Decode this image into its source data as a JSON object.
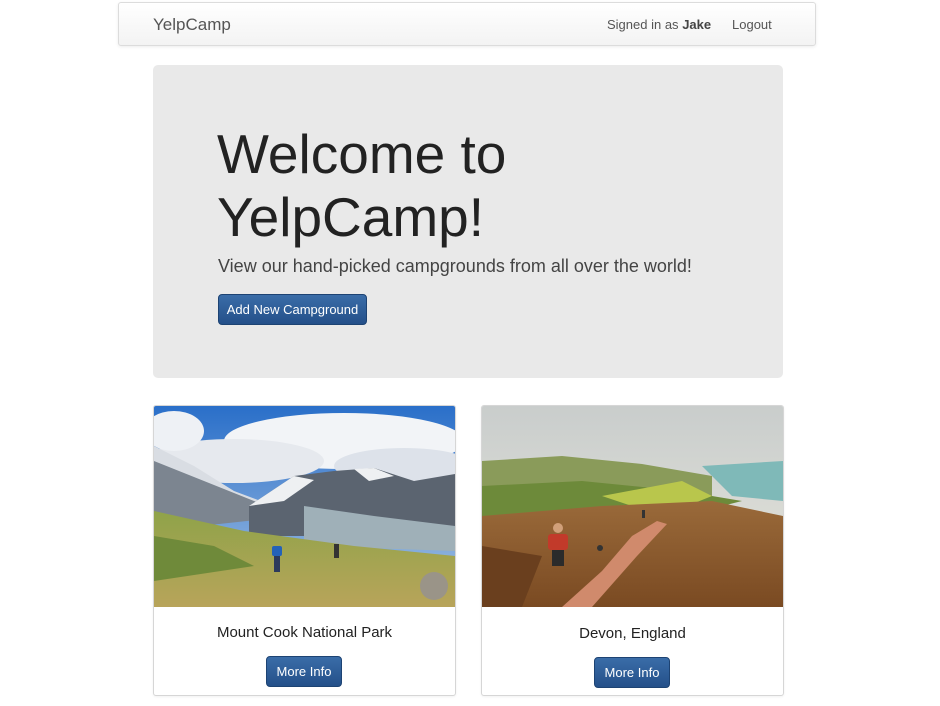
{
  "navbar": {
    "brand": "YelpCamp",
    "signed_in_prefix": "Signed in as",
    "username": "Jake",
    "logout_label": "Logout"
  },
  "jumbotron": {
    "heading": "Welcome to YelpCamp!",
    "subheading": "View our hand-picked campgrounds from all over the world!",
    "add_button_label": "Add New Campground"
  },
  "campgrounds": [
    {
      "name": "Mount Cook National Park",
      "button_label": "More Info"
    },
    {
      "name": "Devon, England",
      "button_label": "More Info"
    }
  ],
  "colors": {
    "primary_button": "#2d5c97",
    "jumbotron_bg": "#e9e9e9"
  }
}
